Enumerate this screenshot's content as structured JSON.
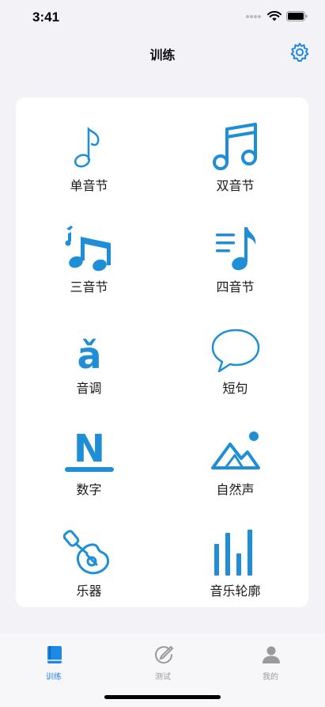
{
  "status_bar": {
    "time": "3:41"
  },
  "nav": {
    "title": "训练"
  },
  "colors": {
    "accent": "#1e88e5",
    "icon_blue": "#1e8fd6",
    "tab_inactive": "#9a9a9a",
    "background": "#f2f2f7"
  },
  "grid": {
    "items": [
      {
        "label": "单音节",
        "icon": "eighth-note-icon"
      },
      {
        "label": "双音节",
        "icon": "beamed-notes-icon"
      },
      {
        "label": "三音节",
        "icon": "triplet-notes-icon"
      },
      {
        "label": "四音节",
        "icon": "playlist-note-icon"
      },
      {
        "label": "音调",
        "icon": "tone-a-icon",
        "glyph": "ǎ"
      },
      {
        "label": "短句",
        "icon": "speech-bubble-icon"
      },
      {
        "label": "数字",
        "icon": "letter-n-icon",
        "glyph": "N"
      },
      {
        "label": "自然声",
        "icon": "mountain-landscape-icon"
      },
      {
        "label": "乐器",
        "icon": "guitar-icon"
      },
      {
        "label": "音乐轮廓",
        "icon": "bar-levels-icon"
      }
    ]
  },
  "tabs": [
    {
      "label": "训练",
      "icon": "book-icon",
      "active": true
    },
    {
      "label": "测试",
      "icon": "pen-circle-icon",
      "active": false
    },
    {
      "label": "我的",
      "icon": "person-icon",
      "active": false
    }
  ]
}
